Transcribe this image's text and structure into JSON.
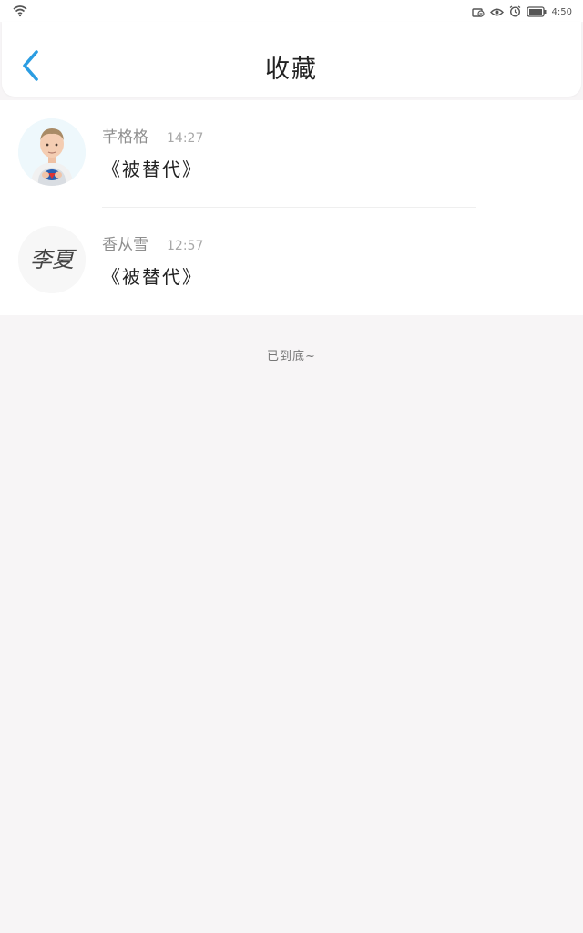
{
  "status_bar": {
    "time": "4:50",
    "icons": [
      "wifi-icon",
      "notification-icon",
      "eye-icon",
      "alarm-icon",
      "battery-icon"
    ]
  },
  "header": {
    "title": "收藏",
    "back_icon": "chevron-left-icon",
    "accent_color": "#2b9de2"
  },
  "favorites": [
    {
      "user": "芊格格",
      "time": "14:27",
      "title": "《被替代》",
      "avatar": "child-photo"
    },
    {
      "user": "香从雪",
      "time": "12:57",
      "title": "《被替代》",
      "avatar": "signature-李夏"
    }
  ],
  "avatar_signature_text": "李夏",
  "footer": {
    "end_text": "已到底~"
  }
}
